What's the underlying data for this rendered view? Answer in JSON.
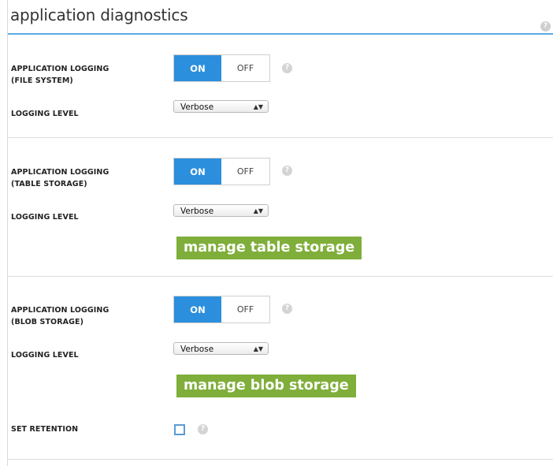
{
  "header": {
    "title": "application diagnostics",
    "help_icon": "help-icon"
  },
  "sections": [
    {
      "logging_label_1": "APPLICATION LOGGING",
      "logging_label_2": "(FILE SYSTEM)",
      "toggle_on": "ON",
      "toggle_off": "OFF",
      "toggle_state": "ON",
      "level_label": "LOGGING LEVEL",
      "level_value": "Verbose"
    },
    {
      "logging_label_1": "APPLICATION LOGGING",
      "logging_label_2": "(TABLE STORAGE)",
      "toggle_on": "ON",
      "toggle_off": "OFF",
      "toggle_state": "ON",
      "level_label": "LOGGING LEVEL",
      "level_value": "Verbose",
      "manage_button": "manage table storage"
    },
    {
      "logging_label_1": "APPLICATION LOGGING",
      "logging_label_2": "(BLOB STORAGE)",
      "toggle_on": "ON",
      "toggle_off": "OFF",
      "toggle_state": "ON",
      "level_label": "LOGGING LEVEL",
      "level_value": "Verbose",
      "manage_button": "manage blob storage"
    }
  ],
  "retention": {
    "label": "SET RETENTION",
    "checked": false
  },
  "colors": {
    "accent_blue": "#2b8fdd",
    "button_green": "#7fae3a",
    "title_rule": "#5aa9e0"
  }
}
